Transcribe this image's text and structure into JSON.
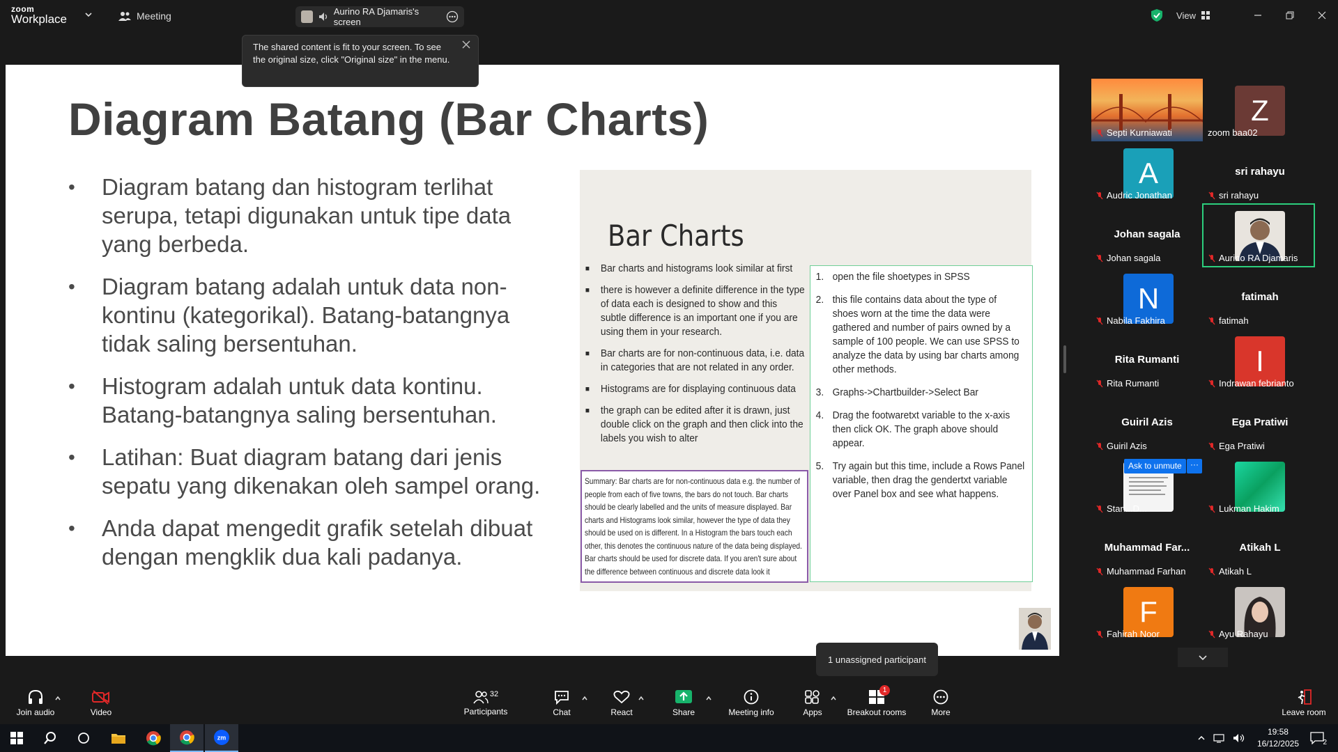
{
  "titlebar": {
    "logo_line1": "zoom",
    "logo_line2": "Workplace",
    "meeting_label": "Meeting",
    "screen_label": "Aurino RA Djamaris's screen",
    "view_label": "View"
  },
  "tooltip": {
    "text": "The shared content is fit to your screen. To see the original size, click \"Original size\" in the menu."
  },
  "slide": {
    "title": "Diagram Batang (Bar Charts)",
    "bullets": [
      "Diagram batang dan histogram terlihat serupa, tetapi digunakan untuk tipe data yang berbeda.",
      "Diagram batang adalah untuk data non-kontinu (kategorikal). Batang-batangnya tidak saling bersentuhan.",
      "Histogram adalah untuk data kontinu. Batang-batangnya saling bersentuhan.",
      "Latihan: Buat diagram batang dari jenis sepatu yang dikenakan oleh sampel orang.",
      "Anda dapat mengedit grafik setelah dibuat dengan mengklik dua kali padanya."
    ],
    "embed": {
      "title": "Bar Charts",
      "left_items": [
        "Bar charts and histograms look similar at first",
        "there is however a definite difference in the type of data each is designed to show and this subtle difference is an important one if you are using them in your research.",
        "Bar charts are for non-continuous data, i.e. data in categories that are not related in any order.",
        "Histograms are for displaying continuous data",
        "the graph can be edited after it is drawn, just double click on the graph and then click into the labels you wish to alter"
      ],
      "steps": [
        {
          "n": "1.",
          "text": "open the file shoetypes in SPSS"
        },
        {
          "n": "2.",
          "text": "this file contains data about the type of shoes worn at the time the data were gathered and number of pairs owned by a sample of 100 people. We can use SPSS to analyze the data by using bar charts among other methods."
        },
        {
          "n": "3.",
          "text": "Graphs->Chartbuilder->Select Bar"
        },
        {
          "n": "4.",
          "text": "Drag the footwaretxt variable to the x-axis then click OK. The graph above should appear."
        },
        {
          "n": "5.",
          "text": "Try again but this time, include a Rows Panel variable, then drag the gendertxt variable over Panel box and see what happens."
        }
      ],
      "summary": "Summary: Bar charts are for non-continuous data e.g. the number of people from each of five towns, the bars do not touch. Bar charts should be clearly labelled and the units of measure displayed. Bar charts and Histograms look similar, however the type of data they should be used on is different. In a Histogram the bars touch each other, this denotes the continuous nature of the data being displayed. Bar charts should be used for discrete data. If you aren't sure about the difference between continuous and discrete data look it"
    }
  },
  "participants": [
    {
      "name": "Septi Kurniawati",
      "type": "photo"
    },
    {
      "name": "zoom baa02",
      "type": "letter",
      "letter": "Z",
      "color": "#6b3a35"
    },
    {
      "name": "Audric Jonathan",
      "type": "letter",
      "letter": "A",
      "color": "#1aa0b8"
    },
    {
      "name": "sri rahayu",
      "type": "name",
      "display": "sri rahayu"
    },
    {
      "name": "Johan sagala",
      "type": "name",
      "display": "Johan sagala"
    },
    {
      "name": "Aurino RA Djamaris",
      "type": "photo"
    },
    {
      "name": "Nabila Fakhira",
      "type": "letter",
      "letter": "N",
      "color": "#0e6ad8"
    },
    {
      "name": "fatimah",
      "type": "name",
      "display": "fatimah"
    },
    {
      "name": "Rita Rumanti",
      "type": "name",
      "display": "Rita Rumanti"
    },
    {
      "name": "Indrawan febrianto",
      "type": "letter",
      "letter": "I",
      "color": "#d9362b"
    },
    {
      "name": "Guiril Azis",
      "type": "name",
      "display": "Guiril Azis"
    },
    {
      "name": "Ega Pratiwi",
      "type": "name",
      "display": "Ega Pratiwi"
    },
    {
      "name": "Stan...D...",
      "type": "photo"
    },
    {
      "name": "Lukman Hakim",
      "type": "photo"
    },
    {
      "name": "Muhammad Farhan",
      "type": "name",
      "display": "Muhammad Far..."
    },
    {
      "name": "Atikah L",
      "type": "name",
      "display": "Atikah L"
    },
    {
      "name": "Fahirah Noor",
      "type": "letter",
      "letter": "F",
      "color": "#f07a12"
    },
    {
      "name": "Ayu Rahayu",
      "type": "photo"
    }
  ],
  "ask_to_unmute": "Ask to unmute",
  "ask_more": "···",
  "unassigned": "1 unassigned participant",
  "toolbar": {
    "join_audio": "Join audio",
    "video": "Video",
    "participants": "Participants",
    "participants_count": "32",
    "chat": "Chat",
    "react": "React",
    "share": "Share",
    "meeting_info": "Meeting info",
    "apps": "Apps",
    "breakout": "Breakout rooms",
    "breakout_badge": "1",
    "more": "More",
    "leave": "Leave room"
  },
  "taskbar": {
    "time": "19:58",
    "date": "16/12/2025",
    "notif_count": "2"
  },
  "colors": {
    "green_share": "#17b36b",
    "active_border": "#2ccf7d",
    "blue": "#0e72ed",
    "red_badge": "#e02828"
  }
}
